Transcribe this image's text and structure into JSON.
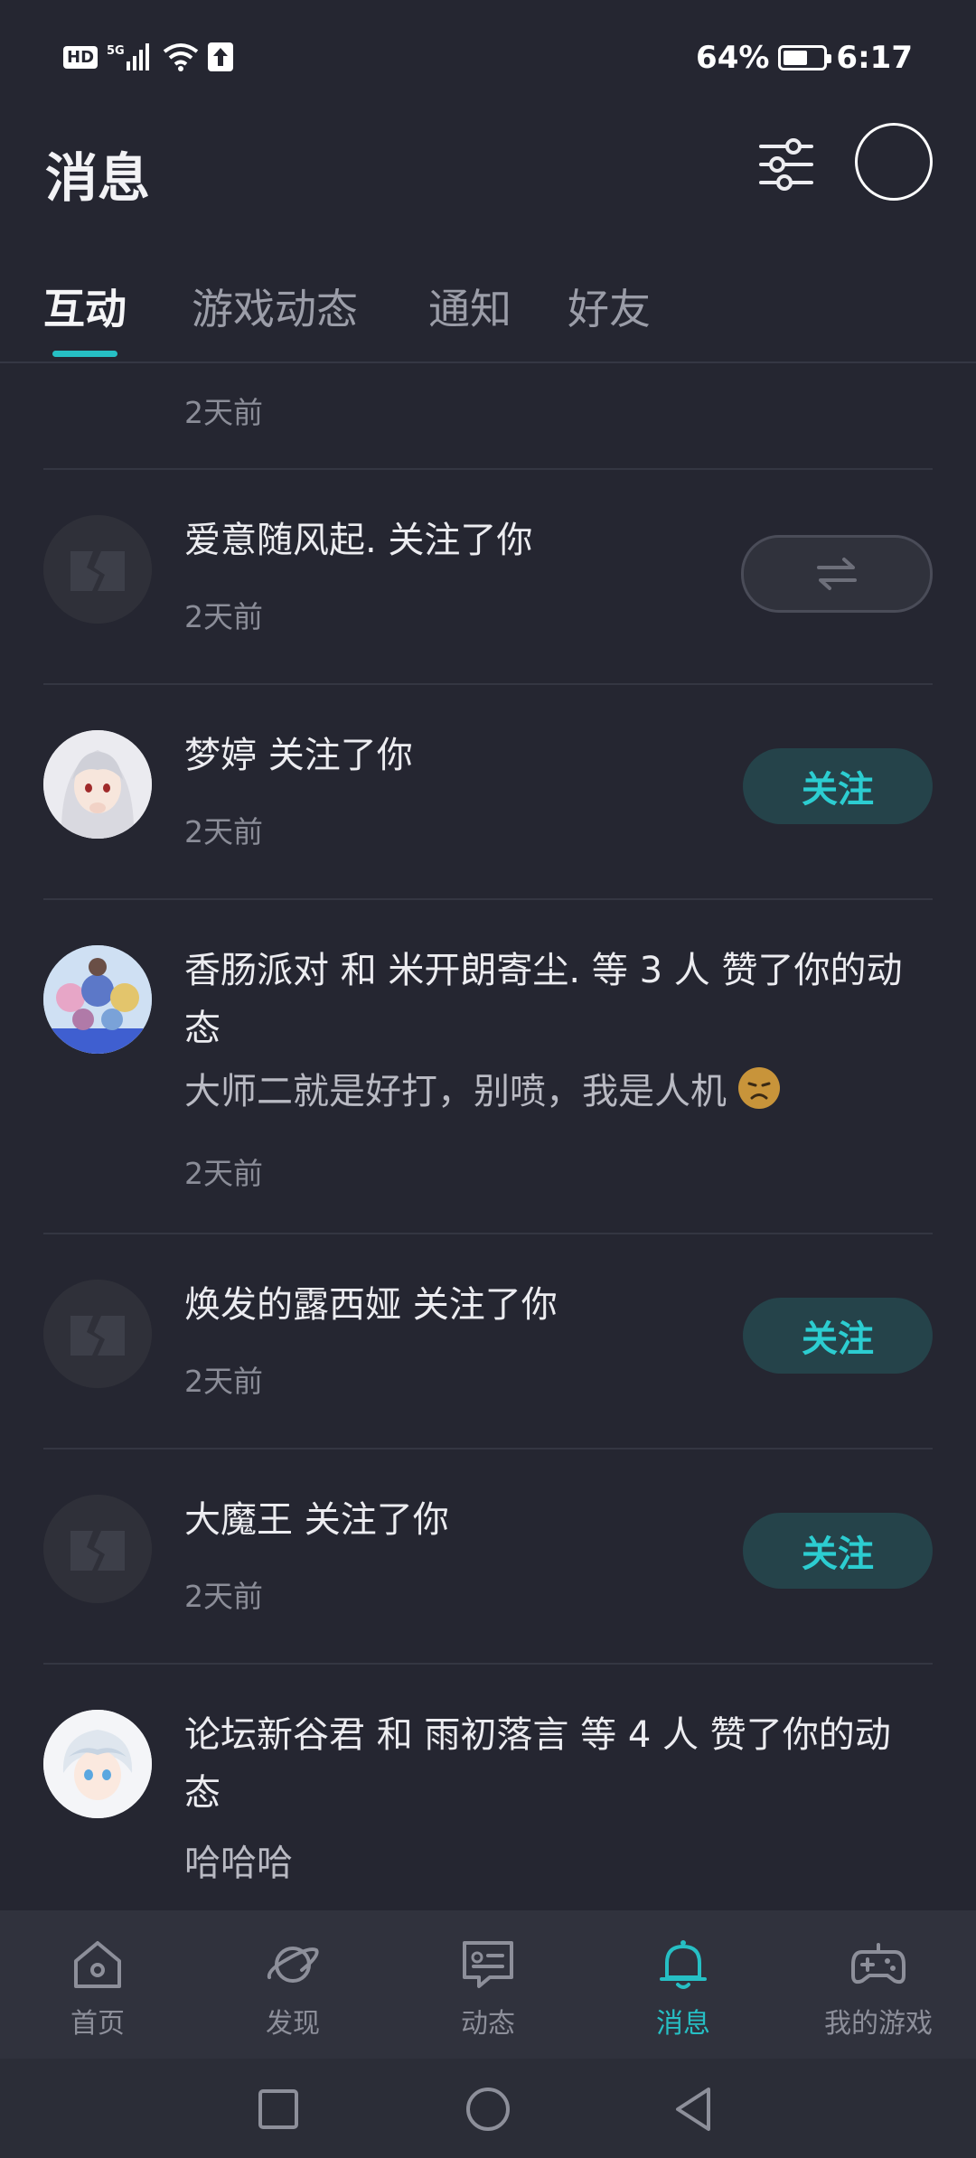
{
  "status_bar": {
    "left_badges": [
      "HD",
      "5G"
    ],
    "battery": "64%",
    "battery_level": 0.64,
    "time": "6:17"
  },
  "header": {
    "title": "消息",
    "icons": [
      "filter-sliders-icon",
      "avatar-circle"
    ]
  },
  "tabs": [
    {
      "label": "互动",
      "active": true
    },
    {
      "label": "游戏动态",
      "active": false
    },
    {
      "label": "通知",
      "active": false
    },
    {
      "label": "好友",
      "active": false
    }
  ],
  "feed": {
    "top_time": "2天前",
    "items": [
      {
        "title": "爱意随风起. 关注了你",
        "time": "2天前",
        "action": "mutual",
        "action_icon": "swap-arrows-icon",
        "avatar": "placeholder"
      },
      {
        "title": "梦婷 关注了你",
        "time": "2天前",
        "action": "关注",
        "avatar": "anime-girl-white-hair"
      },
      {
        "title": "香肠派对 和 米开朗寄尘. 等 3 人 赞了你的动态",
        "subtitle": "大师二就是好打，别喷，我是人机",
        "emoji": "disappointed-face",
        "time": "2天前",
        "avatar": "group-chibi"
      },
      {
        "title": "焕发的露西娅 关注了你",
        "time": "2天前",
        "action": "关注",
        "avatar": "placeholder"
      },
      {
        "title": "大魔王 关注了你",
        "time": "2天前",
        "action": "关注",
        "avatar": "placeholder"
      },
      {
        "title": "论坛新谷君 和 雨初落言 等 4 人 赞了你的动态",
        "subtitle": "哈哈哈",
        "avatar": "anime-boy-white-hair"
      }
    ]
  },
  "bottom_nav": [
    {
      "label": "首页",
      "icon": "home-icon",
      "active": false
    },
    {
      "label": "发现",
      "icon": "planet-icon",
      "active": false
    },
    {
      "label": "动态",
      "icon": "chat-card-icon",
      "active": false
    },
    {
      "label": "消息",
      "icon": "bell-icon",
      "active": true
    },
    {
      "label": "我的游戏",
      "icon": "gamepad-icon",
      "active": false
    }
  ],
  "system_nav": [
    "recent-apps-icon",
    "home-circle-icon",
    "back-icon"
  ],
  "colors": {
    "background": "#252631",
    "accent": "#26bfc4",
    "follow_bg": "#25434a",
    "nav_bg": "#30323d"
  }
}
